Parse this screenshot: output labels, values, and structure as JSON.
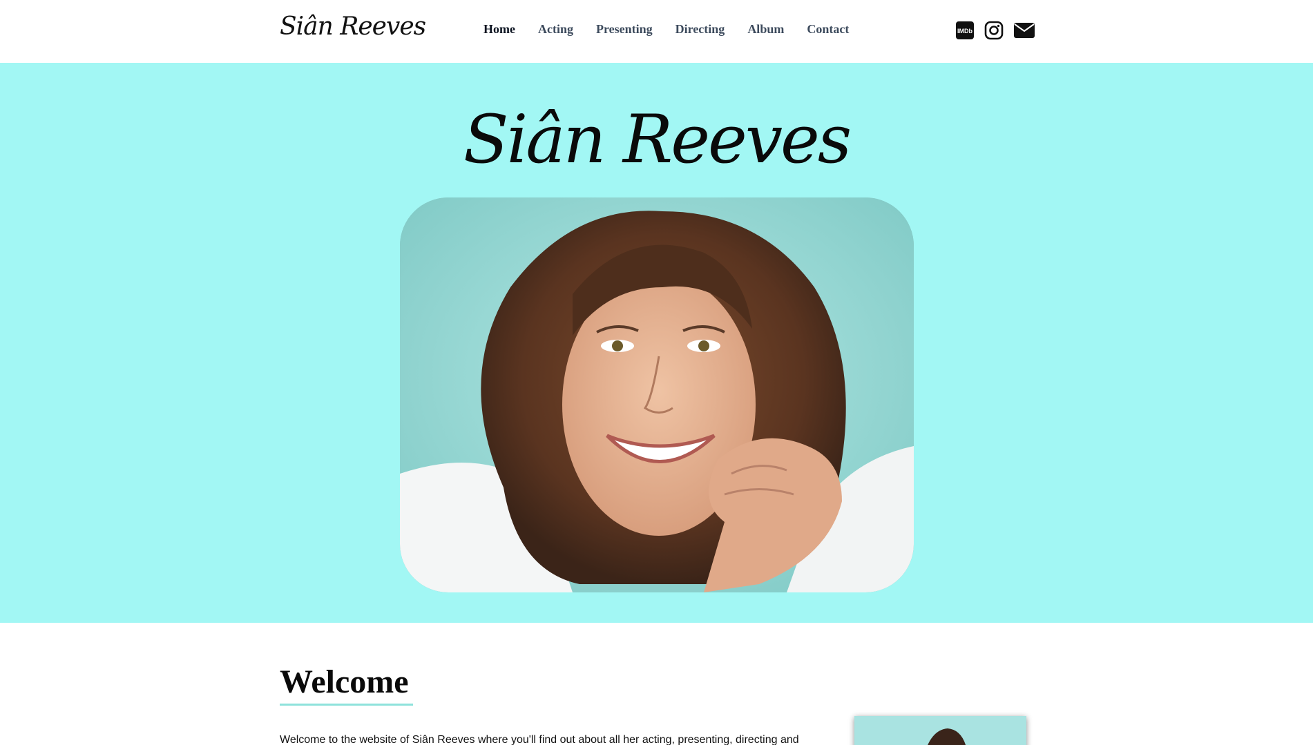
{
  "header": {
    "logo_text": "Siân Reeves",
    "nav": [
      {
        "label": "Home",
        "active": true
      },
      {
        "label": "Acting",
        "active": false
      },
      {
        "label": "Presenting",
        "active": false
      },
      {
        "label": "Directing",
        "active": false
      },
      {
        "label": "Album",
        "active": false
      },
      {
        "label": "Contact",
        "active": false
      }
    ],
    "social": {
      "imdb_label": "IMDb",
      "icons": [
        "imdb-icon",
        "instagram-icon",
        "envelope-icon"
      ]
    }
  },
  "hero": {
    "title": "Siân Reeves",
    "background_color": "#a2f7f4"
  },
  "welcome": {
    "title": "Welcome",
    "text": "Welcome to the website of Siân Reeves where you'll find out about all her acting, presenting, directing and"
  }
}
